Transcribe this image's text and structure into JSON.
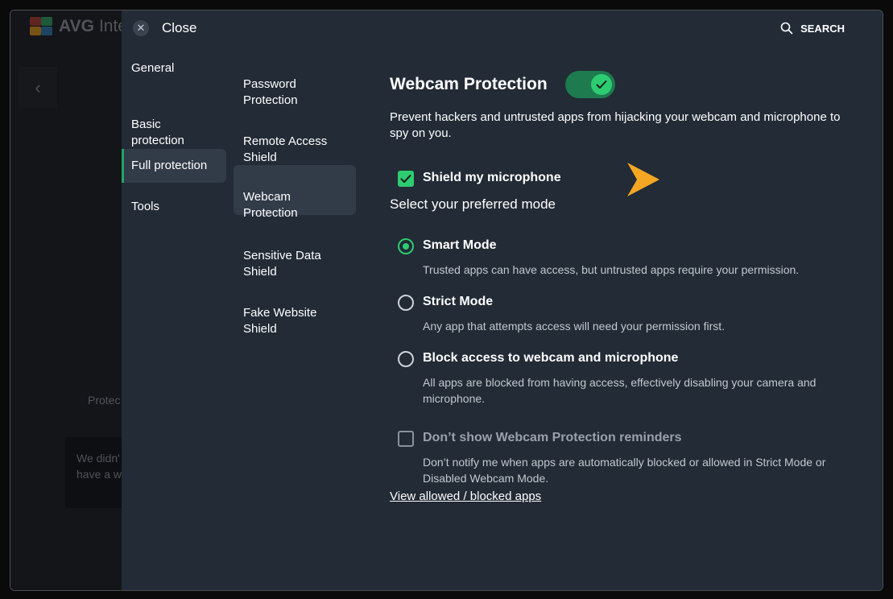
{
  "background": {
    "logo_text": "AVG",
    "title_fragment": "Inte",
    "status_fragment": "Protec",
    "card_text": "We didn'\nhave a w",
    "back_icon": "chevron-left-icon"
  },
  "header": {
    "close_label": "Close",
    "search_label": "SEARCH"
  },
  "nav_primary": [
    {
      "label": "General",
      "active": false
    },
    {
      "label": "Basic\nprotection",
      "active": false
    },
    {
      "label": "Full protection",
      "active": true
    },
    {
      "label": "Tools",
      "active": false
    }
  ],
  "nav_secondary": [
    {
      "label": "Password\nProtection",
      "active": false
    },
    {
      "label": "Remote Access\nShield",
      "active": false
    },
    {
      "label": "Webcam\nProtection",
      "active": true
    },
    {
      "label": "Sensitive Data\nShield",
      "active": false
    },
    {
      "label": "Fake Website\nShield",
      "active": false
    }
  ],
  "main": {
    "title": "Webcam Protection",
    "toggle_on": true,
    "description": "Prevent hackers and untrusted apps from hijacking your webcam and microphone to spy on you.",
    "shield_mic": {
      "label": "Shield my microphone",
      "checked": true
    },
    "mode_label": "Select your preferred mode",
    "modes": [
      {
        "title": "Smart Mode",
        "description": "Trusted apps can have access, but untrusted apps require your permission.",
        "selected": true
      },
      {
        "title": "Strict Mode",
        "description": "Any app that attempts access will need your permission first.",
        "selected": false
      },
      {
        "title": "Block access to webcam and microphone",
        "description": "All apps are blocked from having access, effectively disabling your camera and microphone.",
        "selected": false
      }
    ],
    "reminders": {
      "label": "Don’t show Webcam Protection reminders",
      "description": "Don’t notify me when apps are automatically blocked or allowed in Strict Mode or Disabled Webcam Mode.",
      "checked": false
    },
    "link_label": "View allowed / blocked apps"
  },
  "colors": {
    "panel_bg": "#222b36",
    "accent_green": "#2ecc71",
    "toggle_track": "#1e7a4f",
    "arrow_orange": "#f5a623"
  }
}
